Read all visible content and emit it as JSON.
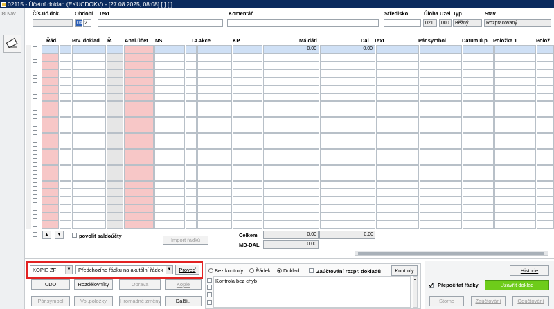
{
  "window": {
    "title": "02115 - Účetní doklad (EKUCDOKV) - [27.08.2025, 08:08]  [ ]  [ ]"
  },
  "nav": {
    "label": "Nav"
  },
  "header": {
    "labels": {
      "doc_no": "Čís.úč.dok.",
      "period": "Období",
      "text": "Text",
      "comment": "Komentář",
      "center": "Středisko",
      "task": "Úloha",
      "node": "Uzel",
      "type": "Typ",
      "state": "Stav"
    },
    "values": {
      "doc_no": "",
      "period_a": "04",
      "period_b": "2",
      "text": "",
      "comment": "",
      "center": "",
      "task": "021",
      "node": "000",
      "type": "Běžný",
      "state": "Rozpracovaný"
    }
  },
  "grid": {
    "columns": [
      "Řád.",
      "Prv. doklad",
      "Ř.",
      "Anal.účet",
      "NS",
      "TA",
      "Akce",
      "KP",
      "Má dáti",
      "Dal",
      "Text",
      "Pár.symbol",
      "Datum ú.p.",
      "Položka 1",
      "Polož"
    ],
    "first_row": {
      "md": "0.00",
      "dal": "0.00"
    },
    "row_count": 23
  },
  "bottom_grid": {
    "povolit_saldo": "povolit saldoúčty",
    "import_button": "Import řádků",
    "celkem_label": "Celkem",
    "celkem_md": "0.00",
    "celkem_dal": "0.00",
    "mddal_label": "MD-DAL",
    "mddal_value": "0.00"
  },
  "actions": {
    "copy_select": "KOPIE ZF",
    "copy_mode_select": "Předchozího řádku na akutální řádek",
    "proved": "Proveď",
    "udd": "UDD",
    "rozdelovniky": "Rozdělovníky",
    "oprava": "Oprava",
    "kopie": "Kopie",
    "par_symbol": "Pár.symbol",
    "vol_polozky": "Vol.položky",
    "hromadne": "Hromadné změny",
    "dalsi": "Další.."
  },
  "control": {
    "bez_kontroly": "Bez kontroly",
    "radek": "Řádek",
    "doklad": "Doklad",
    "zauct": "Zaúčtování rozpr. dokladů",
    "kontroly": "Kontroly",
    "message": "Kontrola bez chyb"
  },
  "right": {
    "historie": "Historie",
    "prepocitat": "Přepočítat řádky",
    "uzavrit": "Uzavřít doklad",
    "storno": "Storno",
    "zauctovani": "Zaúčtování",
    "odzauctovani": "Odúčtování"
  },
  "colors": {
    "title_bar": "#0a2a5e",
    "pink_cell": "#f7c7c7",
    "highlight_row": "#cfe0f5",
    "green_button": "#6ecc1a",
    "red_frame": "#e22222"
  }
}
